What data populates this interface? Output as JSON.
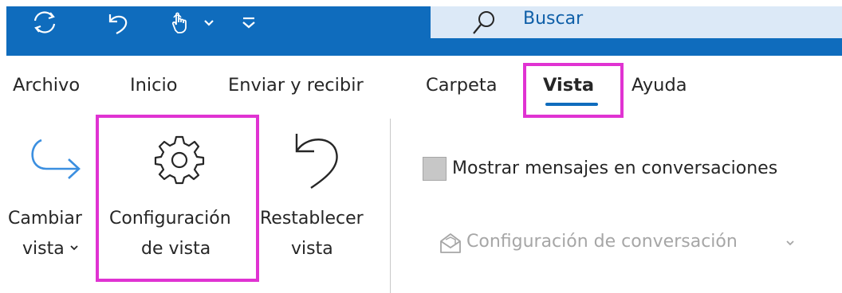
{
  "title_bar": {
    "search_text": "Buscar",
    "colors": {
      "bar": "#0f6cbd",
      "search_bg": "#dce9f7"
    },
    "quick_access_icons": [
      "sync-icon",
      "undo-icon",
      "touch-mode-icon",
      "chevron-down-icon",
      "customize-toolbar-icon"
    ]
  },
  "tabs": {
    "archivo": "Archivo",
    "inicio": "Inicio",
    "enviar_recibir": "Enviar y recibir",
    "carpeta": "Carpeta",
    "vista": "Vista",
    "ayuda": "Ayuda",
    "active": "Vista"
  },
  "ribbon": {
    "change_view": {
      "line1": "Cambiar",
      "line2": "vista",
      "icon": "arrow-right-icon"
    },
    "view_settings": {
      "line1": "Configuración",
      "line2": "de vista",
      "icon": "gear-icon"
    },
    "reset_view": {
      "line1": "Restablecer",
      "line2": "vista",
      "icon": "undo-icon"
    },
    "show_conversations": {
      "label": "Mostrar mensajes en conversaciones",
      "checked": false
    },
    "conversation_settings": {
      "label": "Configuración de conversación",
      "icon": "envelope-icon",
      "enabled": false
    }
  },
  "highlight_color": "#e033d2"
}
